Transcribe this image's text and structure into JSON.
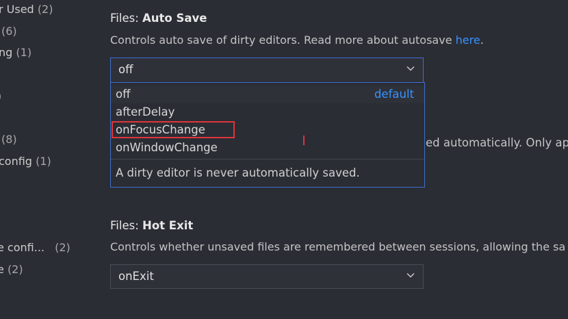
{
  "toc": [
    {
      "label": "r Used",
      "count": "(2)"
    },
    {
      "label": "",
      "count": "(6)"
    },
    {
      "label": "ng",
      "count": "(1)"
    },
    {
      "label": "",
      "count": ")"
    },
    {
      "label": "",
      "count": "(8)"
    },
    {
      "label": "config",
      "count": "(1)"
    },
    {
      "label": "e confi...",
      "count": "(2)"
    },
    {
      "label": "e",
      "count": "(2)"
    }
  ],
  "auto_save": {
    "title_prefix": "Files: ",
    "title_name": "Auto Save",
    "description": "Controls auto save of dirty editors. Read more about autosave ",
    "link_text": "here",
    "description_end": ".",
    "value": "off",
    "options": [
      {
        "label": "off",
        "tag": "default"
      },
      {
        "label": "afterDelay",
        "tag": ""
      },
      {
        "label": "onFocusChange",
        "tag": ""
      },
      {
        "label": "onWindowChange",
        "tag": ""
      }
    ],
    "option_description": "A dirty editor is never automatically saved.",
    "behind_text": "ed automatically. Only app"
  },
  "hot_exit": {
    "title_prefix": "Files: ",
    "title_name": "Hot Exit",
    "description": "Controls whether unsaved files are remembered between sessions, allowing the sa",
    "value": "onExit"
  }
}
